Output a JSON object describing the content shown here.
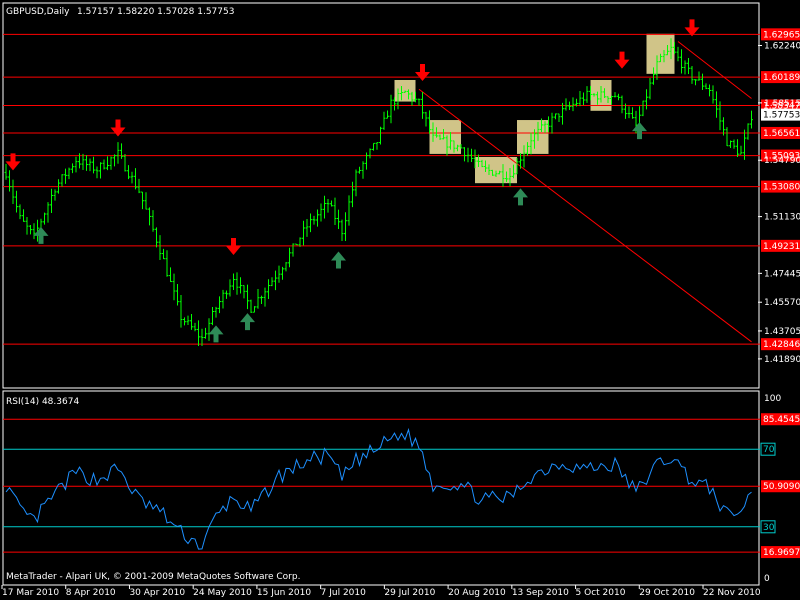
{
  "header": {
    "symbol": "GBPUSD,Daily",
    "ohlc": "1.57157 1.58220 1.57028 1.57753"
  },
  "footer": {
    "copyright": "MetaTrader - Alpari UK, © 2001-2009 MetaQuotes Software Corp."
  },
  "colors": {
    "background": "#000000",
    "frame": "#ffffff",
    "bars": "#00ff00",
    "hline": "#ff0000",
    "trend": "#ff0000",
    "rsi_line": "#1e90ff",
    "rsi_levels": "#00cccc",
    "zone_fill": "#f5e6a0",
    "arrow_down": "#ff0000",
    "arrow_up": "#2e8b57"
  },
  "chart_data": [
    {
      "type": "candlestick",
      "panel": "price",
      "ylim": [
        1.4,
        1.65
      ],
      "y_ticks": [
        "1.62240",
        "1.58515",
        "1.54790",
        "1.51130",
        "1.47445",
        "1.45570",
        "1.43705",
        "1.41890"
      ],
      "x_ticks": [
        "17 Mar 2010",
        "8 Apr 2010",
        "30 Apr 2010",
        "24 May 2010",
        "15 Jun 2010",
        "7 Jul 2010",
        "29 Jul 2010",
        "20 Aug 2010",
        "13 Sep 2010",
        "5 Oct 2010",
        "29 Oct 2010",
        "22 Nov 2010"
      ],
      "current_price": "1.57753",
      "horizontal_levels": [
        {
          "price": 1.62965,
          "label": "1.62965"
        },
        {
          "price": 1.60189,
          "label": "1.60189"
        },
        {
          "price": 1.58347,
          "label": "1.58347"
        },
        {
          "price": 1.56561,
          "label": "1.56561"
        },
        {
          "price": 1.55093,
          "label": "1.55093"
        },
        {
          "price": 1.5308,
          "label": "1.53080"
        },
        {
          "price": 1.49231,
          "label": "1.49231"
        },
        {
          "price": 1.42846,
          "label": "1.42846"
        }
      ],
      "trendlines": [
        {
          "from": {
            "bar": 118,
            "price": 1.594
          },
          "to": {
            "bar": 213,
            "price": 1.43
          }
        },
        {
          "from": {
            "bar": 192,
            "price": 1.625
          },
          "to": {
            "bar": 213,
            "price": 1.588
          }
        }
      ],
      "zones": [
        {
          "bar_from": 111,
          "bar_to": 117,
          "price_top": 1.6,
          "price_bottom": 1.586
        },
        {
          "bar_from": 121,
          "bar_to": 130,
          "price_top": 1.574,
          "price_bottom": 1.552
        },
        {
          "bar_from": 134,
          "bar_to": 146,
          "price_top": 1.55,
          "price_bottom": 1.533
        },
        {
          "bar_from": 146,
          "bar_to": 155,
          "price_top": 1.574,
          "price_bottom": 1.552
        },
        {
          "bar_from": 167,
          "bar_to": 173,
          "price_top": 1.6,
          "price_bottom": 1.58
        },
        {
          "bar_from": 183,
          "bar_to": 191,
          "price_top": 1.63,
          "price_bottom": 1.604
        }
      ],
      "arrows_down": [
        {
          "bar": 2,
          "price": 1.542
        },
        {
          "bar": 32,
          "price": 1.564
        },
        {
          "bar": 65,
          "price": 1.487
        },
        {
          "bar": 119,
          "price": 1.6
        },
        {
          "bar": 176,
          "price": 1.608
        },
        {
          "bar": 196,
          "price": 1.629
        }
      ],
      "arrows_up": [
        {
          "bar": 10,
          "price": 1.504
        },
        {
          "bar": 60,
          "price": 1.44
        },
        {
          "bar": 69,
          "price": 1.448
        },
        {
          "bar": 95,
          "price": 1.488
        },
        {
          "bar": 147,
          "price": 1.529
        },
        {
          "bar": 181,
          "price": 1.572
        }
      ],
      "anchors": [
        {
          "bar": 0,
          "price": 1.54
        },
        {
          "bar": 4,
          "price": 1.51
        },
        {
          "bar": 8,
          "price": 1.498
        },
        {
          "bar": 14,
          "price": 1.53
        },
        {
          "bar": 20,
          "price": 1.548
        },
        {
          "bar": 26,
          "price": 1.542
        },
        {
          "bar": 32,
          "price": 1.552
        },
        {
          "bar": 38,
          "price": 1.528
        },
        {
          "bar": 44,
          "price": 1.49
        },
        {
          "bar": 50,
          "price": 1.446
        },
        {
          "bar": 56,
          "price": 1.432
        },
        {
          "bar": 60,
          "price": 1.452
        },
        {
          "bar": 65,
          "price": 1.472
        },
        {
          "bar": 70,
          "price": 1.452
        },
        {
          "bar": 78,
          "price": 1.476
        },
        {
          "bar": 86,
          "price": 1.505
        },
        {
          "bar": 92,
          "price": 1.52
        },
        {
          "bar": 96,
          "price": 1.502
        },
        {
          "bar": 100,
          "price": 1.538
        },
        {
          "bar": 106,
          "price": 1.56
        },
        {
          "bar": 110,
          "price": 1.585
        },
        {
          "bar": 114,
          "price": 1.592
        },
        {
          "bar": 118,
          "price": 1.585
        },
        {
          "bar": 122,
          "price": 1.562
        },
        {
          "bar": 130,
          "price": 1.556
        },
        {
          "bar": 136,
          "price": 1.542
        },
        {
          "bar": 144,
          "price": 1.538
        },
        {
          "bar": 150,
          "price": 1.562
        },
        {
          "bar": 158,
          "price": 1.578
        },
        {
          "bar": 166,
          "price": 1.59
        },
        {
          "bar": 174,
          "price": 1.59
        },
        {
          "bar": 180,
          "price": 1.57
        },
        {
          "bar": 186,
          "price": 1.61
        },
        {
          "bar": 190,
          "price": 1.62
        },
        {
          "bar": 196,
          "price": 1.602
        },
        {
          "bar": 201,
          "price": 1.594
        },
        {
          "bar": 206,
          "price": 1.56
        },
        {
          "bar": 210,
          "price": 1.552
        },
        {
          "bar": 213,
          "price": 1.577
        }
      ]
    },
    {
      "type": "line",
      "panel": "indicator",
      "title": "RSI(14) 48.3674",
      "ylim": [
        0,
        100
      ],
      "y_ticks": [
        "100",
        "0"
      ],
      "levels": [
        {
          "value": 85.4545,
          "label": "85.4545",
          "style": "red"
        },
        {
          "value": 70,
          "label": "70",
          "style": "cyan"
        },
        {
          "value": 50.909,
          "label": "50.9090",
          "style": "red"
        },
        {
          "value": 30,
          "label": "30",
          "style": "cyan"
        },
        {
          "value": 16.9697,
          "label": "16.9697",
          "style": "red"
        }
      ],
      "anchors": [
        {
          "bar": 0,
          "value": 52
        },
        {
          "bar": 4,
          "value": 38
        },
        {
          "bar": 8,
          "value": 33
        },
        {
          "bar": 14,
          "value": 47
        },
        {
          "bar": 20,
          "value": 58
        },
        {
          "bar": 26,
          "value": 54
        },
        {
          "bar": 32,
          "value": 60
        },
        {
          "bar": 38,
          "value": 44
        },
        {
          "bar": 44,
          "value": 38
        },
        {
          "bar": 50,
          "value": 27
        },
        {
          "bar": 56,
          "value": 20
        },
        {
          "bar": 60,
          "value": 35
        },
        {
          "bar": 65,
          "value": 45
        },
        {
          "bar": 70,
          "value": 38
        },
        {
          "bar": 78,
          "value": 56
        },
        {
          "bar": 86,
          "value": 64
        },
        {
          "bar": 92,
          "value": 67
        },
        {
          "bar": 96,
          "value": 55
        },
        {
          "bar": 100,
          "value": 64
        },
        {
          "bar": 106,
          "value": 70
        },
        {
          "bar": 110,
          "value": 76
        },
        {
          "bar": 114,
          "value": 78
        },
        {
          "bar": 118,
          "value": 72
        },
        {
          "bar": 122,
          "value": 52
        },
        {
          "bar": 130,
          "value": 52
        },
        {
          "bar": 136,
          "value": 44
        },
        {
          "bar": 144,
          "value": 45
        },
        {
          "bar": 150,
          "value": 56
        },
        {
          "bar": 158,
          "value": 63
        },
        {
          "bar": 166,
          "value": 60
        },
        {
          "bar": 174,
          "value": 62
        },
        {
          "bar": 180,
          "value": 48
        },
        {
          "bar": 186,
          "value": 62
        },
        {
          "bar": 190,
          "value": 66
        },
        {
          "bar": 196,
          "value": 54
        },
        {
          "bar": 201,
          "value": 50
        },
        {
          "bar": 206,
          "value": 36
        },
        {
          "bar": 210,
          "value": 38
        },
        {
          "bar": 213,
          "value": 48
        }
      ]
    }
  ]
}
